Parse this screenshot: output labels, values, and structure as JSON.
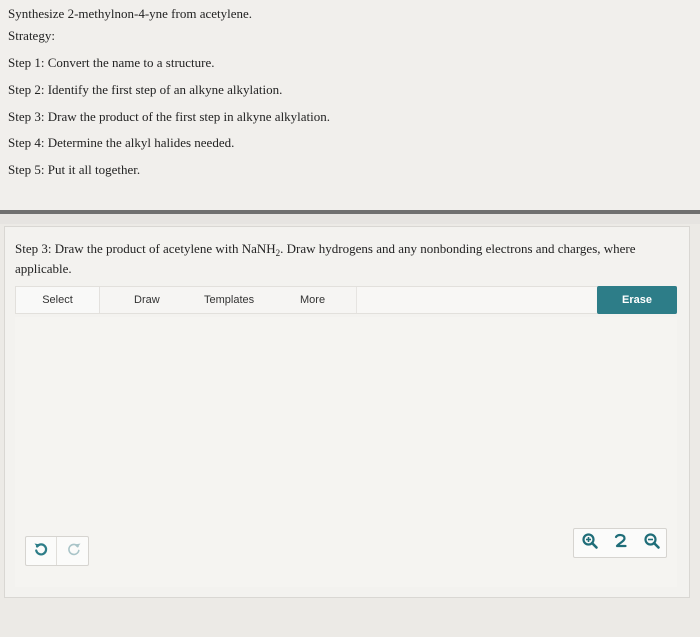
{
  "question": {
    "title": "Synthesize 2-methylnon-4-yne from acetylene.",
    "strategy_label": "Strategy:",
    "steps": [
      "Step 1: Convert the name to a structure.",
      "Step 2: Identify the first step of an alkyne alkylation.",
      "Step 3: Draw the product of the first step in alkyne alkylation.",
      "Step 4: Determine the alkyl halides needed.",
      "Step 5: Put it all together."
    ]
  },
  "panel": {
    "prompt_before": "Step 3: Draw the product of acetylene with NaNH",
    "prompt_sub": "2",
    "prompt_after": ". Draw hydrogens and any nonbonding electrons and charges, where applicable."
  },
  "toolbar": {
    "select_label": "Select",
    "draw_label": "Draw",
    "templates_label": "Templates",
    "more_label": "More",
    "erase_label": "Erase"
  },
  "icons": {
    "undo": "undo-icon",
    "redo": "redo-icon",
    "zoom_in": "zoom-in-icon",
    "reset": "reset-zoom-icon",
    "zoom_out": "zoom-out-icon"
  },
  "colors": {
    "accent": "#2d7d88"
  }
}
